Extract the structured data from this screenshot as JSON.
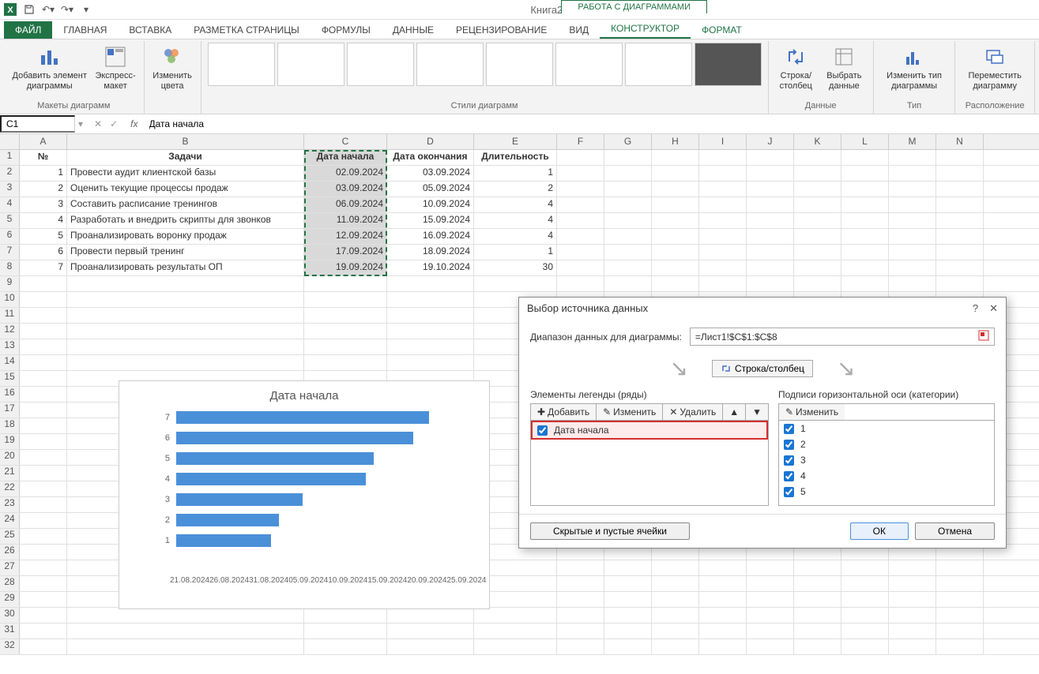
{
  "app": {
    "title": "Книга2 - Excel",
    "context_tab_group": "РАБОТА С ДИАГРАММАМИ"
  },
  "qat": {
    "save": "💾",
    "undo": "↶",
    "redo": "↷"
  },
  "tabs": {
    "file": "ФАЙЛ",
    "home": "ГЛАВНАЯ",
    "insert": "ВСТАВКА",
    "page": "РАЗМЕТКА СТРАНИЦЫ",
    "formulas": "ФОРМУЛЫ",
    "data": "ДАННЫЕ",
    "review": "РЕЦЕНЗИРОВАНИЕ",
    "view": "ВИД",
    "design": "КОНСТРУКТОР",
    "format": "ФОРМАТ"
  },
  "ribbon": {
    "layouts_label": "Макеты диаграмм",
    "add_element": "Добавить элемент диаграммы",
    "quick_layout": "Экспресс-макет",
    "change_colors": "Изменить цвета",
    "styles_label": "Стили диаграмм",
    "data_label": "Данные",
    "switch": "Строка/столбец",
    "select_data": "Выбрать данные",
    "type_label": "Тип",
    "change_type": "Изменить тип диаграммы",
    "location_label": "Расположение",
    "move": "Переместить диаграмму"
  },
  "namebox": "C1",
  "formula": "Дата начала",
  "columns": [
    "A",
    "B",
    "C",
    "D",
    "E",
    "F",
    "G",
    "H",
    "I",
    "J",
    "K",
    "L",
    "M",
    "N"
  ],
  "headers": {
    "A": "№",
    "B": "Задачи",
    "C": "Дата начала",
    "D": "Дата окончания",
    "E": "Длительность"
  },
  "rows": [
    {
      "n": "1",
      "task": "Провести аудит клиентской базы",
      "start": "02.09.2024",
      "end": "03.09.2024",
      "dur": "1"
    },
    {
      "n": "2",
      "task": "Оценить текущие процессы продаж",
      "start": "03.09.2024",
      "end": "05.09.2024",
      "dur": "2"
    },
    {
      "n": "3",
      "task": "Составить расписание тренингов",
      "start": "06.09.2024",
      "end": "10.09.2024",
      "dur": "4"
    },
    {
      "n": "4",
      "task": "Разработать и внедрить скрипты для звонков",
      "start": "11.09.2024",
      "end": "15.09.2024",
      "dur": "4"
    },
    {
      "n": "5",
      "task": "Проанализировать воронку продаж",
      "start": "12.09.2024",
      "end": "16.09.2024",
      "dur": "4"
    },
    {
      "n": "6",
      "task": "Провести первый тренинг",
      "start": "17.09.2024",
      "end": "18.09.2024",
      "dur": "1"
    },
    {
      "n": "7",
      "task": "Проанализировать результаты ОП",
      "start": "19.09.2024",
      "end": "19.10.2024",
      "dur": "30"
    }
  ],
  "chart_data": {
    "type": "bar",
    "title": "Дата начала",
    "categories": [
      "7",
      "6",
      "5",
      "4",
      "3",
      "2",
      "1"
    ],
    "values": [
      320,
      300,
      250,
      240,
      160,
      130,
      120
    ],
    "x_ticks": [
      "21.08.2024",
      "26.08.2024",
      "31.08.2024",
      "05.09.2024",
      "10.09.2024",
      "15.09.2024",
      "20.09.2024",
      "25.09.2024"
    ]
  },
  "dialog": {
    "title": "Выбор источника данных",
    "range_label": "Диапазон данных для диаграммы:",
    "range_value": "=Лист1!$C$1:$C$8",
    "switch_btn": "Строка/столбец",
    "legend_label": "Элементы легенды (ряды)",
    "axis_label": "Подписи горизонтальной оси (категории)",
    "add": "Добавить",
    "edit": "Изменить",
    "delete": "Удалить",
    "series": [
      "Дата начала"
    ],
    "categories": [
      "1",
      "2",
      "3",
      "4",
      "5"
    ],
    "hidden_btn": "Скрытые и пустые ячейки",
    "ok": "ОК",
    "cancel": "Отмена"
  }
}
